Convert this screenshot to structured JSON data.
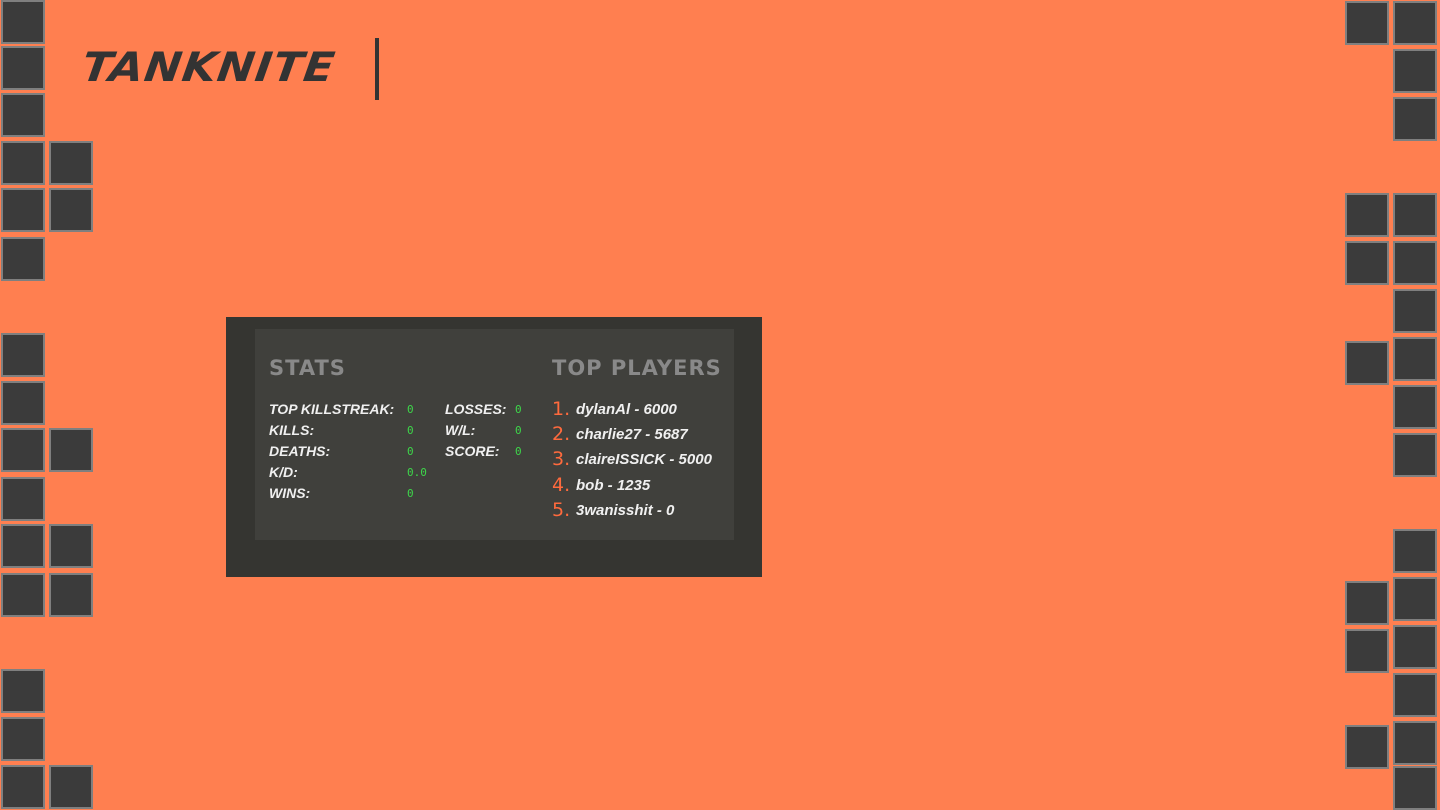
{
  "app": {
    "logo_text": "TANKNITE"
  },
  "stats": {
    "title": "STATS",
    "items": [
      {
        "label": "TOP KILLSTREAK:",
        "value": "0"
      },
      {
        "label": "KILLS:",
        "value": "0"
      },
      {
        "label": "DEATHS:",
        "value": "0"
      },
      {
        "label": "K/D:",
        "value": "0.0"
      },
      {
        "label": "WINS:",
        "value": "0"
      },
      {
        "label": "LOSSES:",
        "value": "0"
      },
      {
        "label": "W/L:",
        "value": "0"
      },
      {
        "label": "SCORE:",
        "value": "0"
      }
    ]
  },
  "top_players": {
    "title": "TOP PLAYERS",
    "players": [
      {
        "rank": "1.",
        "entry": "dylanAl - 6000"
      },
      {
        "rank": "2.",
        "entry": "charlie27 - 5687"
      },
      {
        "rank": "3.",
        "entry": "claireISSICK - 5000"
      },
      {
        "rank": "4.",
        "entry": "bob - 1235"
      },
      {
        "rank": "5.",
        "entry": "3wanisshit - 0"
      }
    ]
  },
  "colors": {
    "background": "#ff7f50",
    "tile": "#3b3b3b",
    "tile_border": "#7f7f7f",
    "panel": "#353531",
    "panel_inner": "#40403c",
    "stat_value": "#3dd64a",
    "rank": "#ff6a3d"
  }
}
